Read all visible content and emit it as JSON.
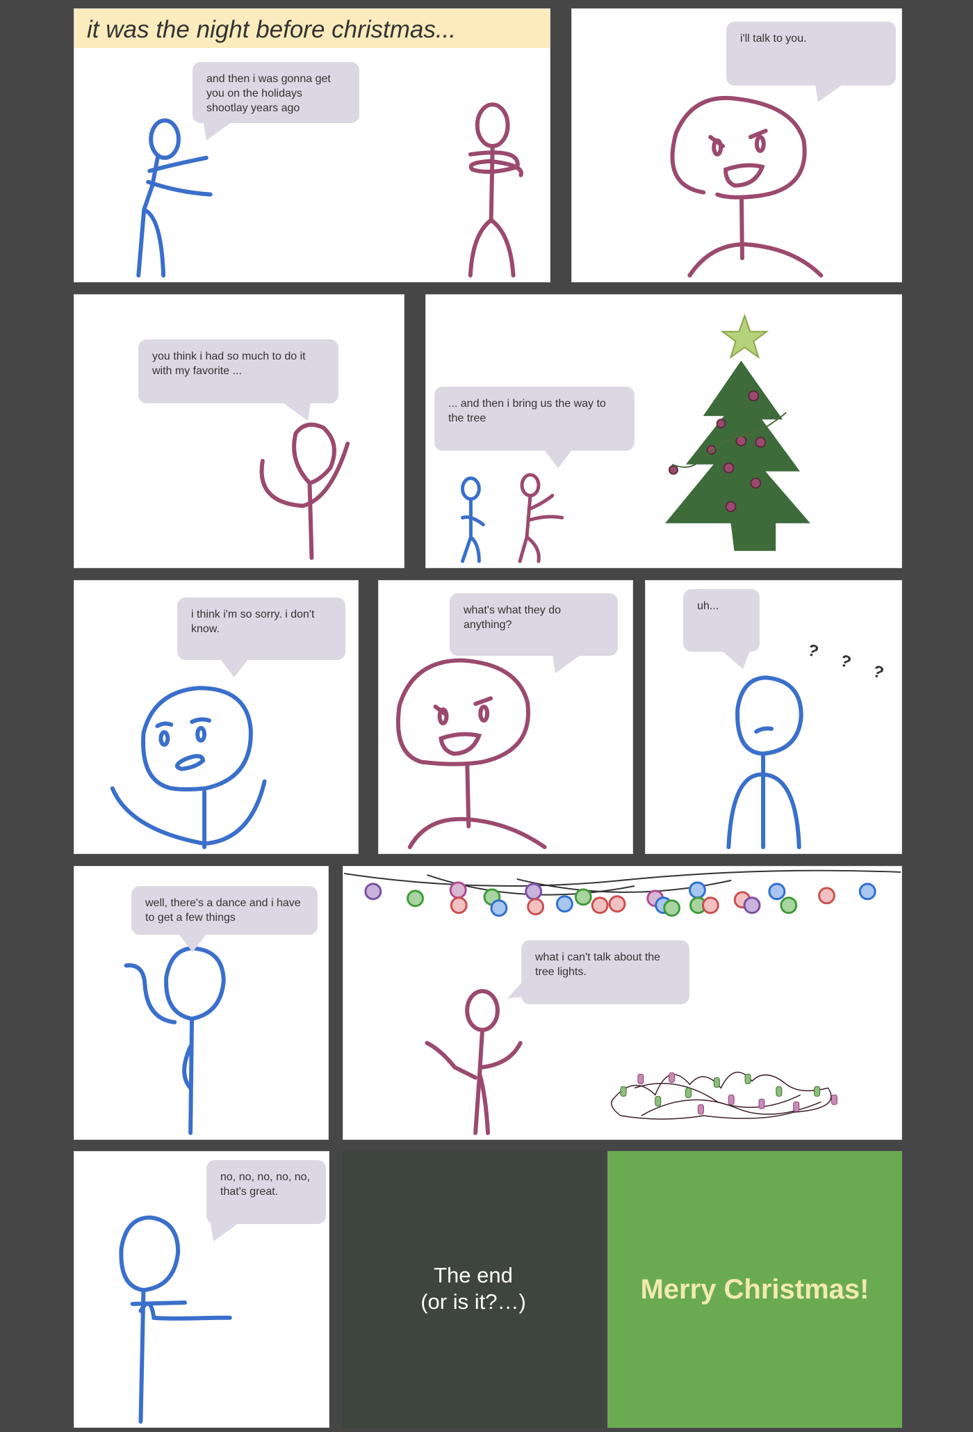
{
  "caption": "it was the night before christmas...",
  "bubbles": {
    "p1": "and then i was gonna get you on the holidays shootlay years ago",
    "p2": "i'll talk to you.",
    "p3": "you think i had so much to do it with my favorite ...",
    "p4": "... and then i bring us the way to the tree",
    "p5": "i think i'm so sorry. i don't know.",
    "p6": "what's what they do anything?",
    "p7": "uh...",
    "p7_marks": "? ? ?",
    "p8": "well, there's a dance and i have to get a few things",
    "p9": "what i can't talk about the tree lights.",
    "p10": "no, no, no, no, no, that's great."
  },
  "end_line1": "The end",
  "end_line2": "(or is it?…)",
  "merry": "Merry Christmas!",
  "colors": {
    "background": "#464646",
    "blue_figure": "#3a6fcb",
    "purple_figure": "#9b4a6e",
    "bubble": "#dcd8e3",
    "caption_bg": "#fbebbd",
    "tree": "#3d6b3a",
    "star": "#b5d27a",
    "end_panel": "#3d453e",
    "merry_panel": "#6aab52",
    "merry_text": "#f2eab0"
  }
}
